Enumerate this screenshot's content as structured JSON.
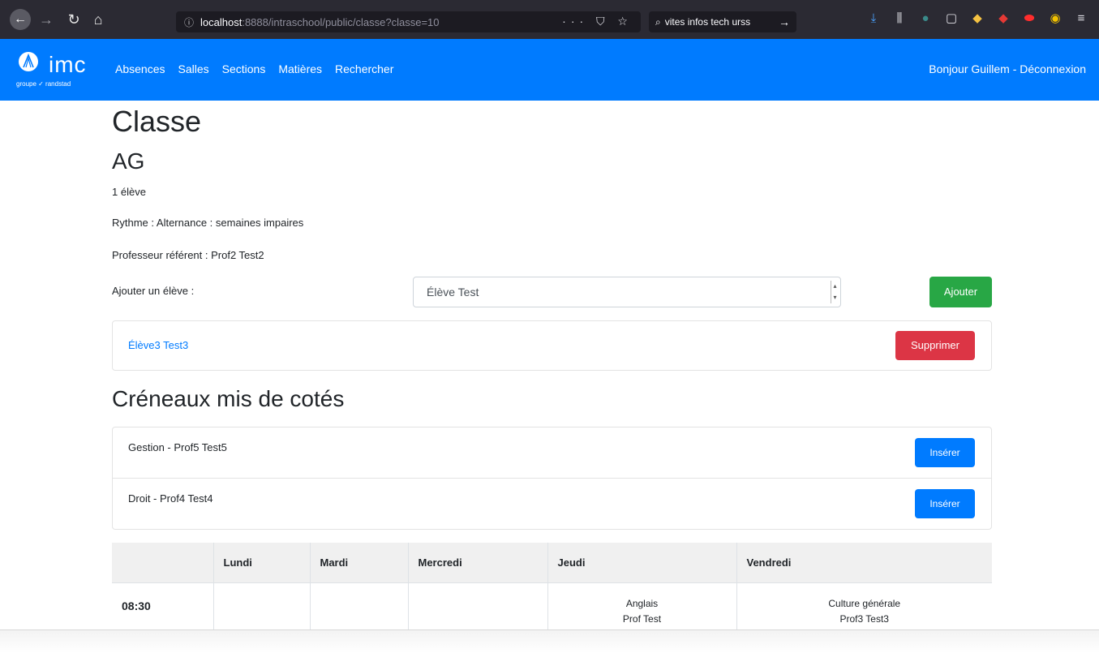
{
  "browser": {
    "url_host": "localhost",
    "url_path": ":8888/intraschool/public/classe?classe=10",
    "url_actions": "··· ⛉ ☆",
    "search_text": "vites infos tech urss"
  },
  "navbar": {
    "brand": "imc",
    "brand_sub": "groupe ✓ randstad",
    "links": [
      "Absences",
      "Salles",
      "Sections",
      "Matières",
      "Rechercher"
    ],
    "user_text": "Bonjour Guillem - Déconnexion"
  },
  "page": {
    "title": "Classe",
    "class_name": "AG",
    "student_count": "1 élève",
    "rythme": "Rythme : Alternance : semaines impaires",
    "referent": "Professeur référent : Prof2 Test2"
  },
  "add_student": {
    "label": "Ajouter un élève :",
    "selected": "Élève Test",
    "button": "Ajouter"
  },
  "students": [
    {
      "name": "Élève3 Test3",
      "action": "Supprimer"
    }
  ],
  "reserved": {
    "title": "Créneaux mis de cotés",
    "items": [
      {
        "text": "Gestion - Prof5 Test5",
        "action": "Insérer"
      },
      {
        "text": "Droit - Prof4 Test4",
        "action": "Insérer"
      }
    ]
  },
  "timetable": {
    "headers": [
      "",
      "Lundi",
      "Mardi",
      "Mercredi",
      "Jeudi",
      "Vendredi"
    ],
    "rows": [
      {
        "time": "08:30",
        "cells": [
          {
            "subject": "",
            "teacher": ""
          },
          {
            "subject": "",
            "teacher": ""
          },
          {
            "subject": "",
            "teacher": ""
          },
          {
            "subject": "Anglais",
            "teacher": "Prof Test"
          },
          {
            "subject": "Culture générale",
            "teacher": "Prof3 Test3"
          }
        ]
      }
    ]
  },
  "colors": {
    "primary": "#007bff",
    "success": "#28a745",
    "danger": "#dc3545"
  }
}
